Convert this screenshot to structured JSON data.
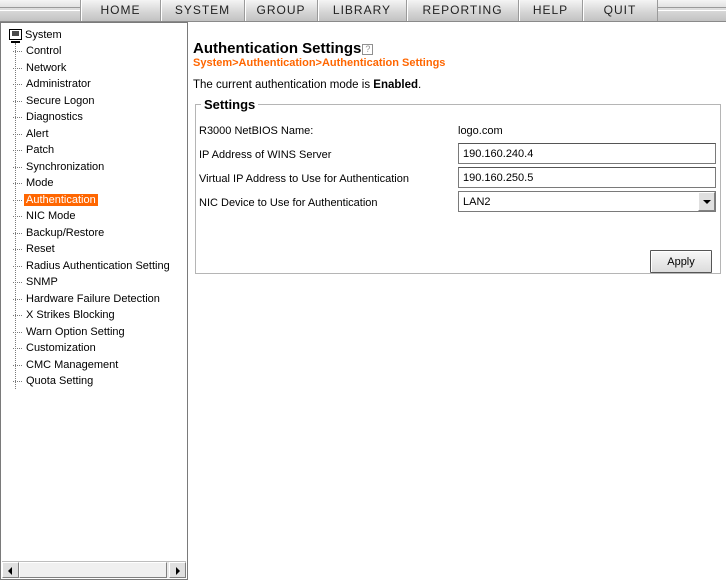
{
  "menu": {
    "items": [
      "HOME",
      "SYSTEM",
      "GROUP",
      "LIBRARY",
      "REPORTING",
      "HELP",
      "QUIT"
    ]
  },
  "sidebar": {
    "root_label": "System",
    "items": [
      "Control",
      "Network",
      "Administrator",
      "Secure Logon",
      "Diagnostics",
      "Alert",
      "Patch",
      "Synchronization",
      "Mode",
      "Authentication",
      "NIC Mode",
      "Backup/Restore",
      "Reset",
      "Radius Authentication Setting",
      "SNMP",
      "Hardware Failure Detection",
      "X Strikes Blocking",
      "Warn Option Setting",
      "Customization",
      "CMC Management",
      "Quota Setting"
    ],
    "selected": "Authentication"
  },
  "page": {
    "title": "Authentication Settings",
    "help_icon": "?",
    "breadcrumb": "System>Authentication>Authentication Settings",
    "mode_prefix": "The current authentication mode is ",
    "mode_value": "Enabled",
    "mode_suffix": "."
  },
  "settings": {
    "legend": "Settings",
    "netbios_label": "R3000 NetBIOS Name:",
    "netbios_value": "logo.com",
    "wins_label": "IP Address of WINS Server",
    "wins_value": "190.160.240.4",
    "virtual_ip_label": "Virtual IP Address to Use for Authentication",
    "virtual_ip_value": "190.160.250.5",
    "nic_label": "NIC Device to Use for Authentication",
    "nic_value": "LAN2",
    "apply_label": "Apply"
  },
  "colors": {
    "accent": "#ff6600",
    "menubar": "#d4d4d4"
  }
}
